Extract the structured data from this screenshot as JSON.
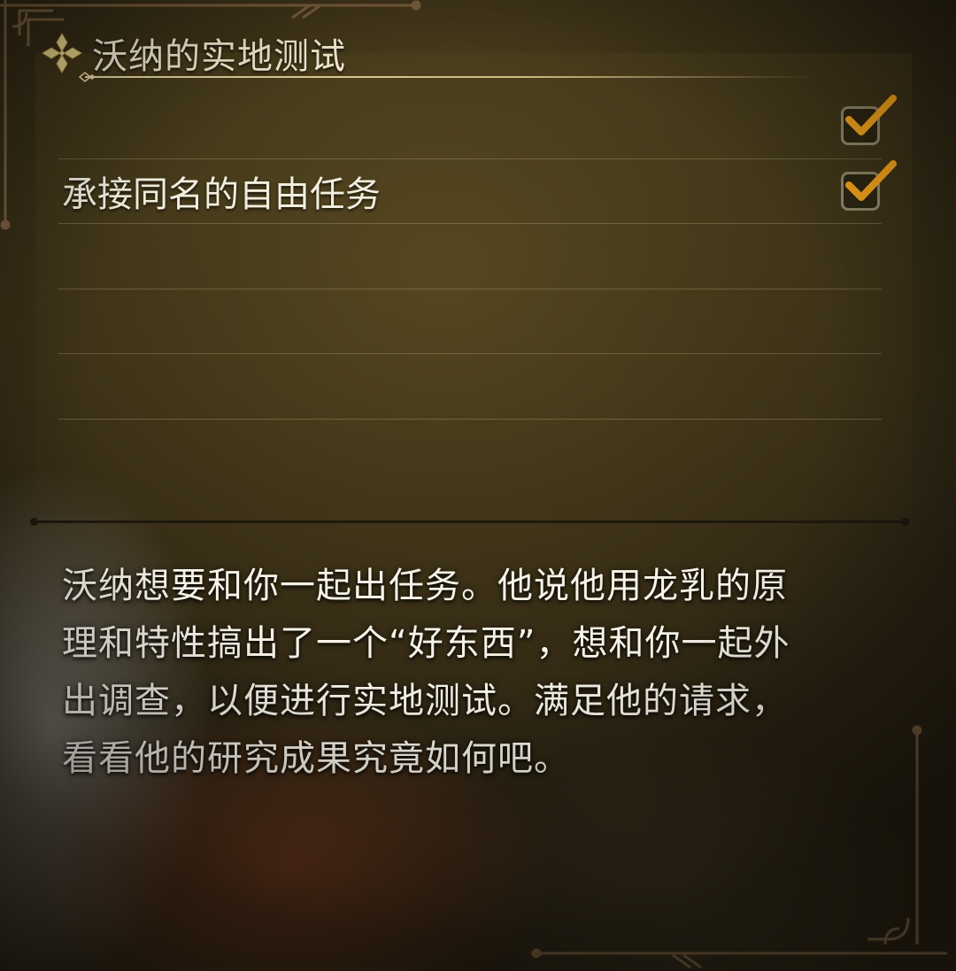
{
  "quest": {
    "title": "沃纳的实地测试",
    "title_icon": "quest-diamond-icon",
    "objectives": [
      {
        "label": "",
        "completed": true
      },
      {
        "label": "承接同名的自由任务",
        "completed": true
      },
      {
        "label": "",
        "completed": false
      },
      {
        "label": "",
        "completed": false
      },
      {
        "label": "",
        "completed": false
      }
    ],
    "description": "沃纳想要和你一起出任务。他说他用龙乳的原理和特性搞出了一个“好东西”，想和你一起外出调查，以便进行实地测试。满足他的请求，看看他的研究成果究竟如何吧。"
  },
  "colors": {
    "accent_check": "#f2a21c",
    "title_text": "#f4ead0",
    "frame": "#6b5234"
  }
}
